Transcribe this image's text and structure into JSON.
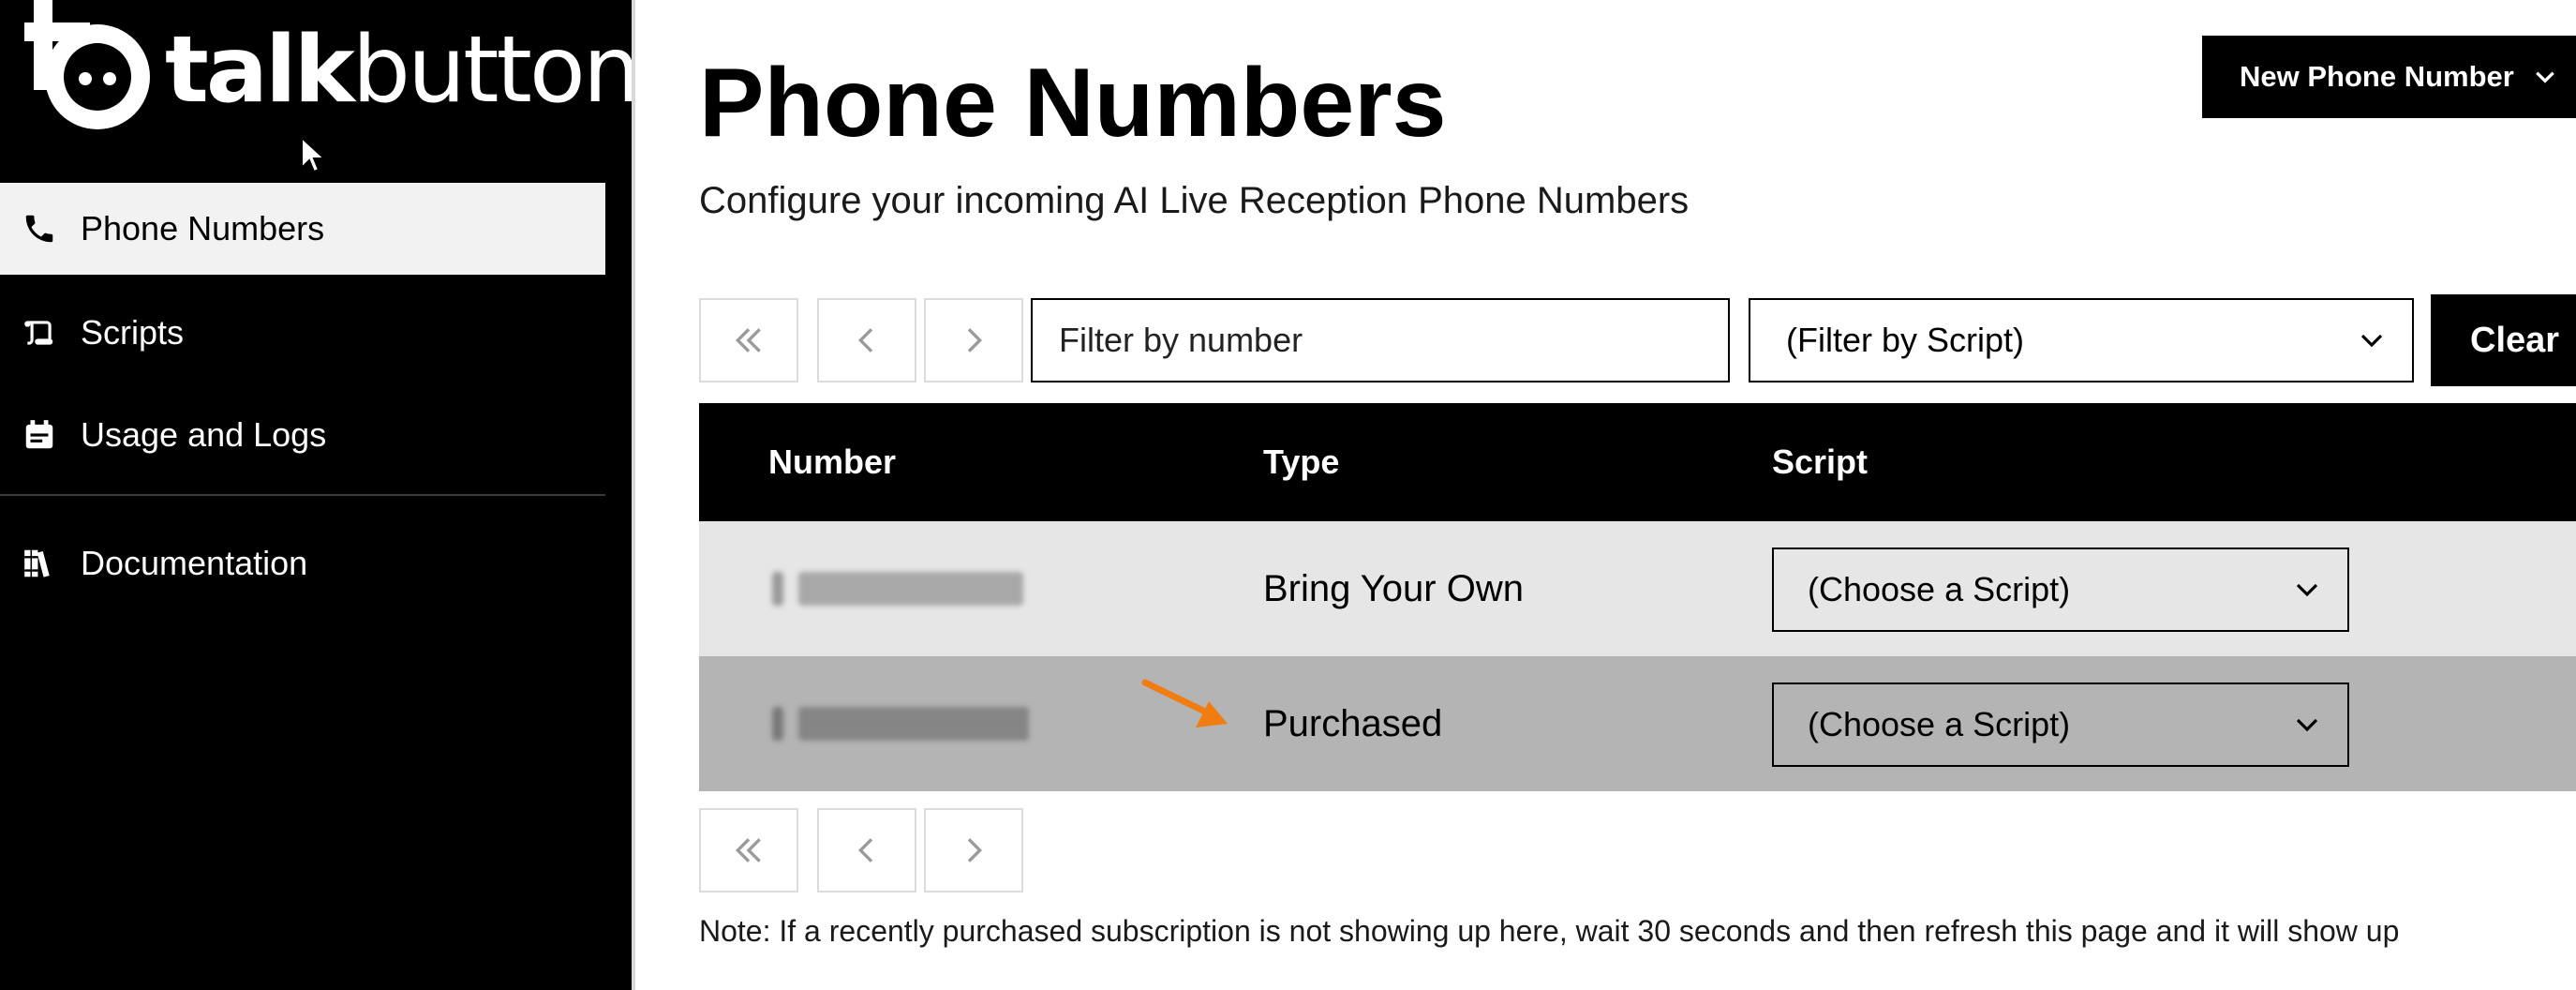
{
  "sidebar": {
    "logo": {
      "brand_bold": "talk",
      "brand_light": "button"
    },
    "items": [
      {
        "label": "Phone Numbers",
        "icon": "phone-icon",
        "active": true
      },
      {
        "label": "Scripts",
        "icon": "scroll-icon",
        "active": false
      },
      {
        "label": "Usage and Logs",
        "icon": "calendar-icon",
        "active": false
      },
      {
        "label": "Documentation",
        "icon": "books-icon",
        "active": false
      }
    ]
  },
  "header": {
    "title": "Phone Numbers",
    "subtitle": "Configure your incoming AI Live Reception Phone Numbers",
    "new_button_label": "New Phone Number"
  },
  "filters": {
    "number_placeholder": "Filter by number",
    "script_selected": "(Filter by Script)",
    "clear_label": "Clear"
  },
  "table": {
    "columns": [
      "Number",
      "Type",
      "Script"
    ],
    "rows": [
      {
        "number": "",
        "type": "Bring Your Own",
        "script": "(Choose a Script)"
      },
      {
        "number": "",
        "type": "Purchased",
        "script": "(Choose a Script)"
      }
    ]
  },
  "note": "Note: If a recently purchased subscription is not showing up here, wait 30 seconds and then refresh this page and it will show up",
  "colors": {
    "sidebar_bg": "#000000",
    "active_nav_bg": "#f2f2f2",
    "row_light": "#e6e6e6",
    "row_dark": "#b4b4b4",
    "annotation_arrow": "#f07c12"
  }
}
